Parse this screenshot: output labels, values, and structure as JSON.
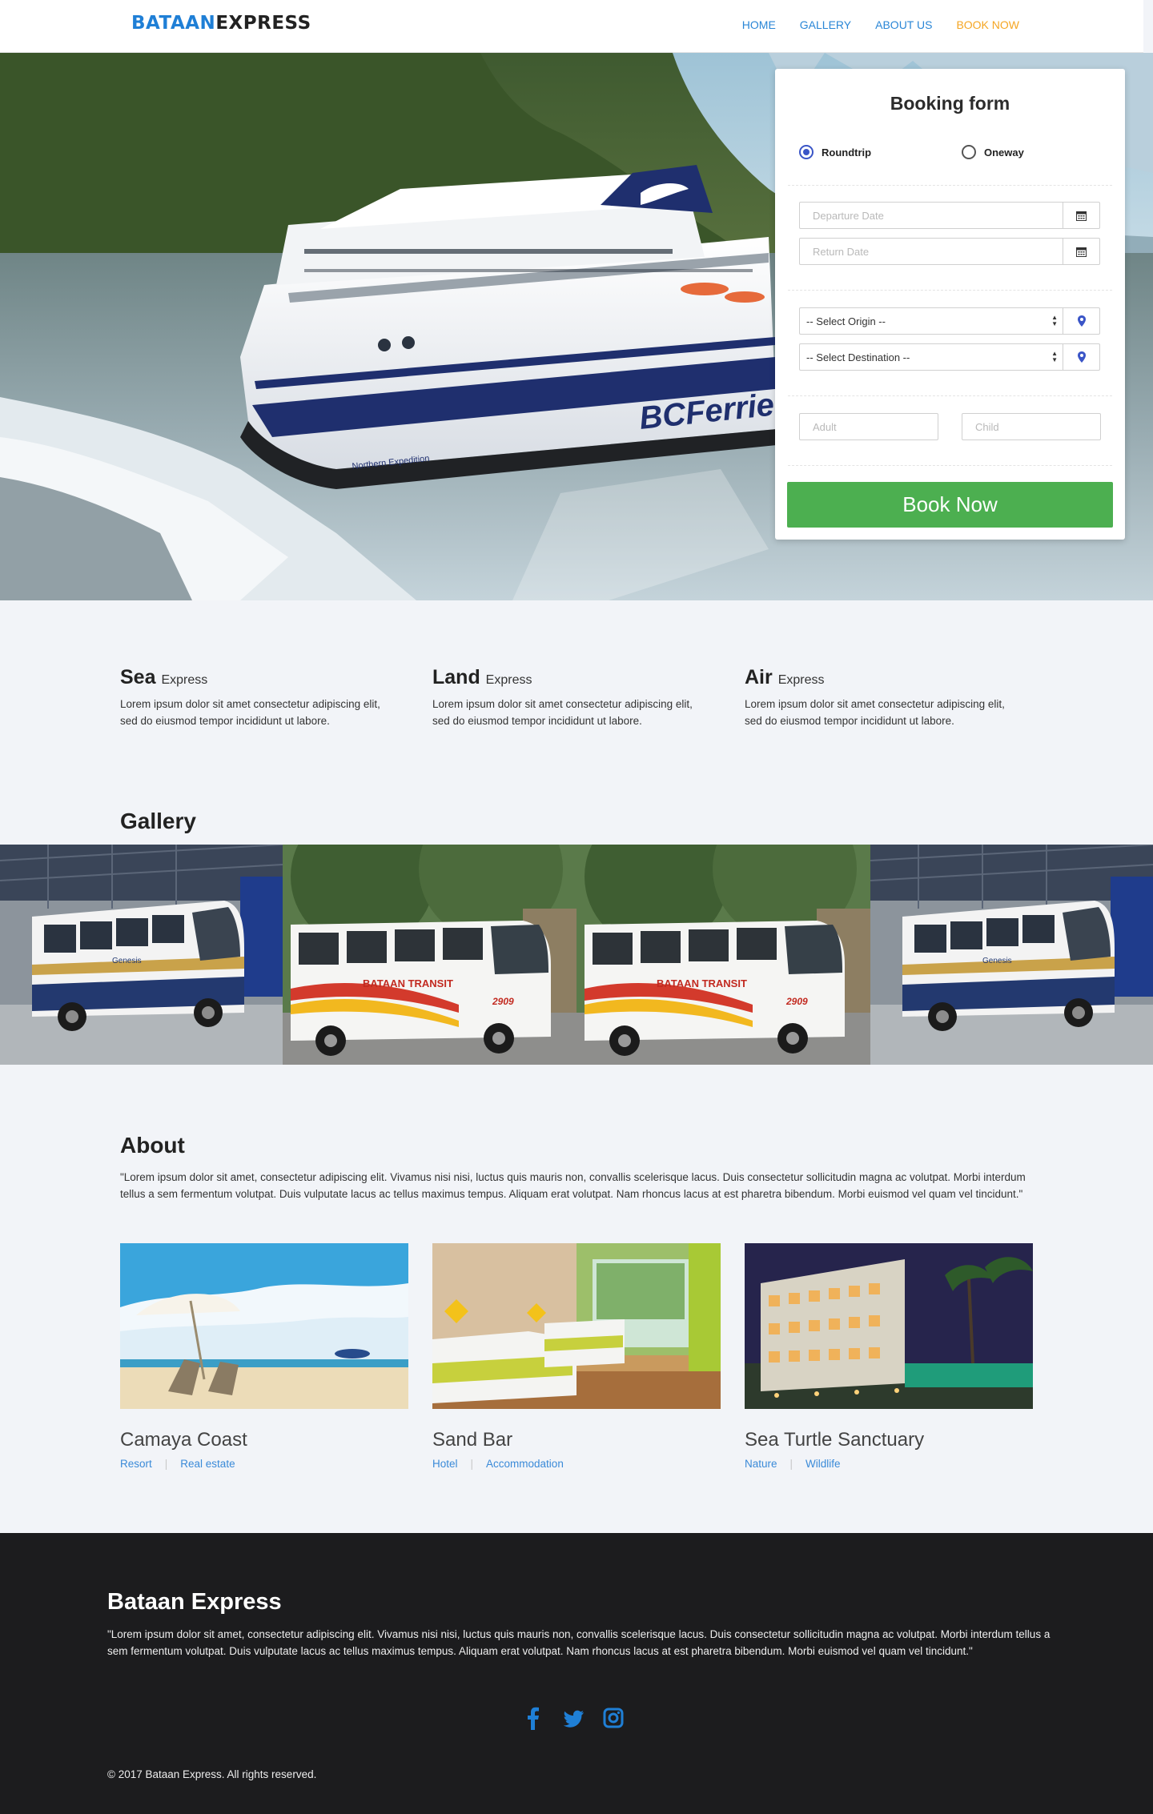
{
  "brand": {
    "part1": "BATAAN",
    "part2": "EXPRESS"
  },
  "nav": [
    {
      "label": "HOME"
    },
    {
      "label": "GALLERY"
    },
    {
      "label": "ABOUT US"
    },
    {
      "label": "BOOK NOW"
    }
  ],
  "booking": {
    "title": "Booking form",
    "trip_types": [
      "Roundtrip",
      "Oneway"
    ],
    "selected_trip": "Roundtrip",
    "departure_placeholder": "Departure Date",
    "return_placeholder": "Return Date",
    "origin_value": "-- Select Origin --",
    "destination_value": "-- Select Destination --",
    "adult_placeholder": "Adult",
    "child_placeholder": "Child",
    "submit_label": "Book Now"
  },
  "hero": {
    "ship_brand": "BCFerries",
    "ship_name": "Northern Expedition"
  },
  "services": [
    {
      "title": "Sea",
      "sub": "Express",
      "text": "Lorem ipsum dolor sit amet consectetur adipiscing elit, sed do eiusmod tempor incididunt ut labore."
    },
    {
      "title": "Land",
      "sub": "Express",
      "text": "Lorem ipsum dolor sit amet consectetur adipiscing elit, sed do eiusmod tempor incididunt ut labore."
    },
    {
      "title": "Air",
      "sub": "Express",
      "text": "Lorem ipsum dolor sit amet consectetur adipiscing elit, sed do eiusmod tempor incididunt ut labore."
    }
  ],
  "gallery": {
    "title": "Gallery",
    "bus_labels": {
      "transit": "BATAAN TRANSIT",
      "number": "2909",
      "side": "Genesis"
    }
  },
  "about": {
    "title": "About",
    "text": "\"Lorem ipsum dolor sit amet, consectetur adipiscing elit. Vivamus nisi nisi, luctus quis mauris non, convallis scelerisque lacus. Duis consectetur sollicitudin magna ac volutpat. Morbi interdum tellus a sem fermentum volutpat. Duis vulputate lacus ac tellus maximus tempus. Aliquam erat volutpat. Nam rhoncus lacus at est pharetra bibendum. Morbi euismod vel quam vel tincidunt.\"",
    "destinations": [
      {
        "name": "Camaya Coast",
        "tags": [
          "Resort",
          "Real estate"
        ]
      },
      {
        "name": "Sand Bar",
        "tags": [
          "Hotel",
          "Accommodation"
        ]
      },
      {
        "name": "Sea Turtle Sanctuary",
        "tags": [
          "Nature",
          "Wildlife"
        ]
      }
    ]
  },
  "footer": {
    "title": "Bataan Express",
    "text": "\"Lorem ipsum dolor sit amet, consectetur adipiscing elit. Vivamus nisi nisi, luctus quis mauris non, convallis scelerisque lacus. Duis consectetur sollicitudin magna ac volutpat. Morbi interdum tellus a sem fermentum volutpat. Duis vulputate lacus ac tellus maximus tempus. Aliquam erat volutpat. Nam rhoncus lacus at est pharetra bibendum. Morbi euismod vel quam vel tincidunt.\"",
    "social_icons": [
      "facebook-icon",
      "twitter-icon",
      "instagram-icon"
    ],
    "social_color": "#1f7fd6",
    "copyright": "© 2017 Bataan Express. All rights reserved."
  },
  "colors": {
    "accent": "#1f7fd6",
    "active_nav": "#f5a623",
    "book_button": "#4caf50",
    "footer_bg": "#1c1c1e",
    "radio": "#3a55c7"
  }
}
